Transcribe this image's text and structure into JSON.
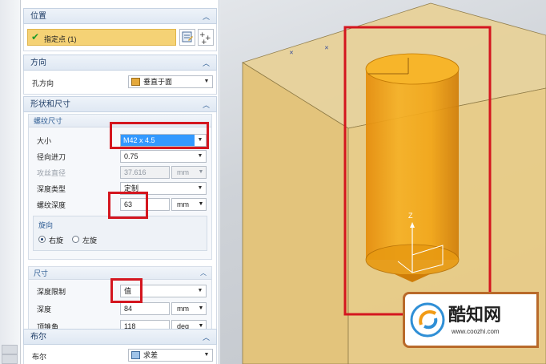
{
  "sections": {
    "position": {
      "title": "位置",
      "selection_label": "指定点 (1)"
    },
    "direction": {
      "title": "方向",
      "hole_direction_label": "孔方向",
      "hole_direction_value": "垂直于面"
    },
    "shape": {
      "title": "形状和尺寸",
      "thread": {
        "title": "螺纹尺寸",
        "size_label": "大小",
        "size_value": "M42 x 4.5",
        "radial_feed_label": "径向进刀",
        "radial_feed_value": "0.75",
        "tap_drill_label": "攻丝直径",
        "tap_drill_value": "37.616",
        "tap_drill_unit": "mm",
        "depth_type_label": "深度类型",
        "depth_type_value": "定制",
        "thread_depth_label": "螺纹深度",
        "thread_depth_value": "63",
        "thread_depth_unit": "mm",
        "rotation": {
          "title": "旋向",
          "right_label": "右旋",
          "left_label": "左旋",
          "selected": "右旋"
        }
      },
      "dimensions": {
        "title": "尺寸",
        "depth_limit_label": "深度限制",
        "depth_limit_value": "值",
        "depth_label": "深度",
        "depth_value": "84",
        "depth_unit": "mm",
        "tip_angle_label": "顶锥角",
        "tip_angle_value": "118",
        "tip_angle_unit": "deg"
      }
    },
    "boolean": {
      "title": "布尔",
      "label": "布尔",
      "value": "求差"
    }
  },
  "viewport": {
    "axis_label": "Z"
  },
  "watermark": {
    "logo_text": "酷知网",
    "url": "www.coozhi.com"
  },
  "colors": {
    "highlight_red": "#d4161f",
    "selection_yellow": "#f5d275",
    "cylinder_orange": "#f2a516",
    "block_tan": "#e0c078",
    "accent_blue": "#2d5c93"
  }
}
